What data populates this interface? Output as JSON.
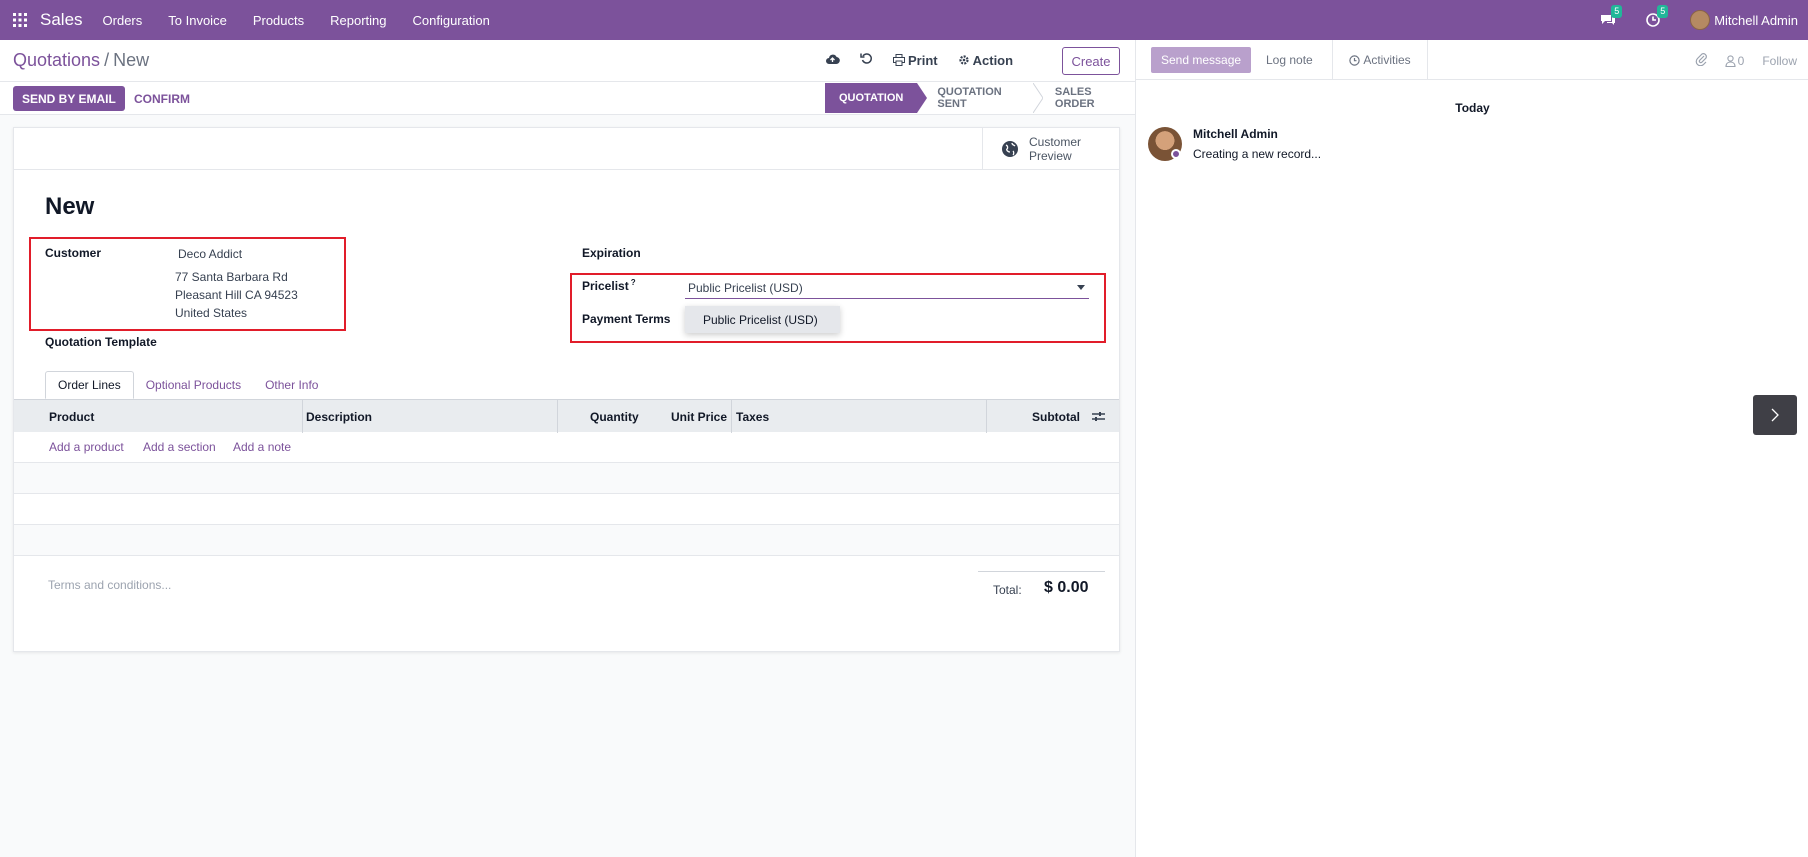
{
  "navbar": {
    "brand": "Sales",
    "menu": [
      "Orders",
      "To Invoice",
      "Products",
      "Reporting",
      "Configuration"
    ],
    "messages_count": "5",
    "activities_count": "5",
    "user_name": "Mitchell Admin",
    "accent_color": "#7c529b"
  },
  "breadcrumb": {
    "parent": "Quotations",
    "separator": "/",
    "current": "New"
  },
  "toolbar": {
    "print_label": "Print",
    "action_label": "Action",
    "create_label": "Create"
  },
  "statusbar": {
    "send_email_label": "SEND BY EMAIL",
    "confirm_label": "CONFIRM",
    "stages": [
      "QUOTATION",
      "QUOTATION SENT",
      "SALES ORDER"
    ],
    "active_stage": "QUOTATION"
  },
  "smart_button": {
    "line1": "Customer",
    "line2": "Preview"
  },
  "form": {
    "title": "New",
    "customer_label": "Customer",
    "customer_name": "Deco Addict",
    "address_line1": "77 Santa Barbara Rd",
    "address_line2": "Pleasant Hill CA 94523",
    "address_line3": "United States",
    "quotation_template_label": "Quotation Template",
    "expiration_label": "Expiration",
    "pricelist_label": "Pricelist",
    "pricelist_help": "?",
    "pricelist_value": "Public Pricelist (USD)",
    "payment_terms_label": "Payment Terms",
    "dropdown_options": [
      "Public Pricelist (USD)"
    ]
  },
  "tabs": [
    "Order Lines",
    "Optional Products",
    "Other Info"
  ],
  "order_lines": {
    "columns": [
      "Product",
      "Description",
      "Quantity",
      "Unit Price",
      "Taxes",
      "Subtotal"
    ],
    "add_product": "Add a product",
    "add_section": "Add a section",
    "add_note": "Add a note"
  },
  "footer": {
    "terms_placeholder": "Terms and conditions...",
    "total_label": "Total:",
    "total_value": "$ 0.00"
  },
  "chatter": {
    "send_message_label": "Send message",
    "log_note_label": "Log note",
    "activities_label": "Activities",
    "followers_count": "0",
    "follow_label": "Follow",
    "date_separator": "Today",
    "message_author": "Mitchell Admin",
    "message_body": "Creating a new record..."
  }
}
